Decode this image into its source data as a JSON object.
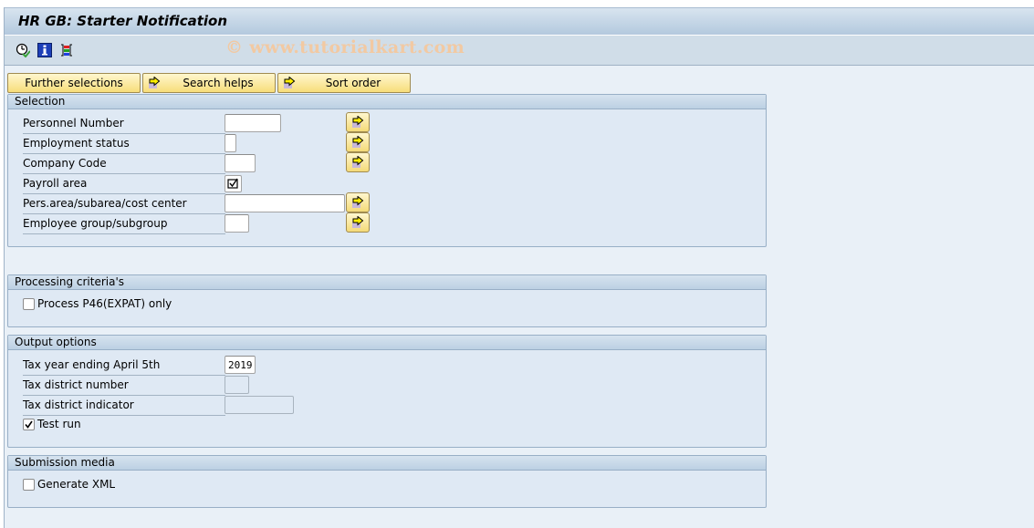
{
  "window": {
    "title": "HR GB: Starter Notification",
    "watermark": "© www.tutorialkart.com"
  },
  "toolbar": {
    "icons": [
      "execute-icon",
      "info-icon",
      "layout-icon"
    ]
  },
  "action_buttons": [
    {
      "label": "Further selections",
      "icon": null
    },
    {
      "label": "Search helps",
      "icon": "arrow-right-icon"
    },
    {
      "label": "Sort order",
      "icon": "arrow-right-icon"
    }
  ],
  "groups": {
    "selection": {
      "title": "Selection",
      "rows": [
        {
          "label": "Personnel Number",
          "value": "",
          "type": "input",
          "multiple_selection": true
        },
        {
          "label": "Employment status",
          "value": "",
          "type": "input",
          "multiple_selection": true
        },
        {
          "label": "Company Code",
          "value": "",
          "type": "input",
          "multiple_selection": true
        },
        {
          "label": "Payroll area",
          "value": "",
          "type": "checkbox-field",
          "checked": true,
          "multiple_selection": false
        },
        {
          "label": "Pers.area/subarea/cost center",
          "value": "",
          "type": "input",
          "multiple_selection": true
        },
        {
          "label": "Employee group/subgroup",
          "value": "",
          "type": "input",
          "multiple_selection": true
        }
      ]
    },
    "processing": {
      "title": "Processing criteria's",
      "checkboxes": [
        {
          "label": "Process P46(EXPAT) only",
          "checked": false
        }
      ]
    },
    "output": {
      "title": "Output options",
      "rows": [
        {
          "label": "Tax year ending April 5th",
          "value": "2019",
          "enabled": true
        },
        {
          "label": "Tax district number",
          "value": "",
          "enabled": false
        },
        {
          "label": "Tax district indicator",
          "value": "",
          "enabled": false
        }
      ],
      "checkboxes": [
        {
          "label": "Test run",
          "checked": true
        }
      ]
    },
    "submission": {
      "title": "Submission media",
      "checkboxes": [
        {
          "label": "Generate XML",
          "checked": false
        }
      ]
    }
  }
}
